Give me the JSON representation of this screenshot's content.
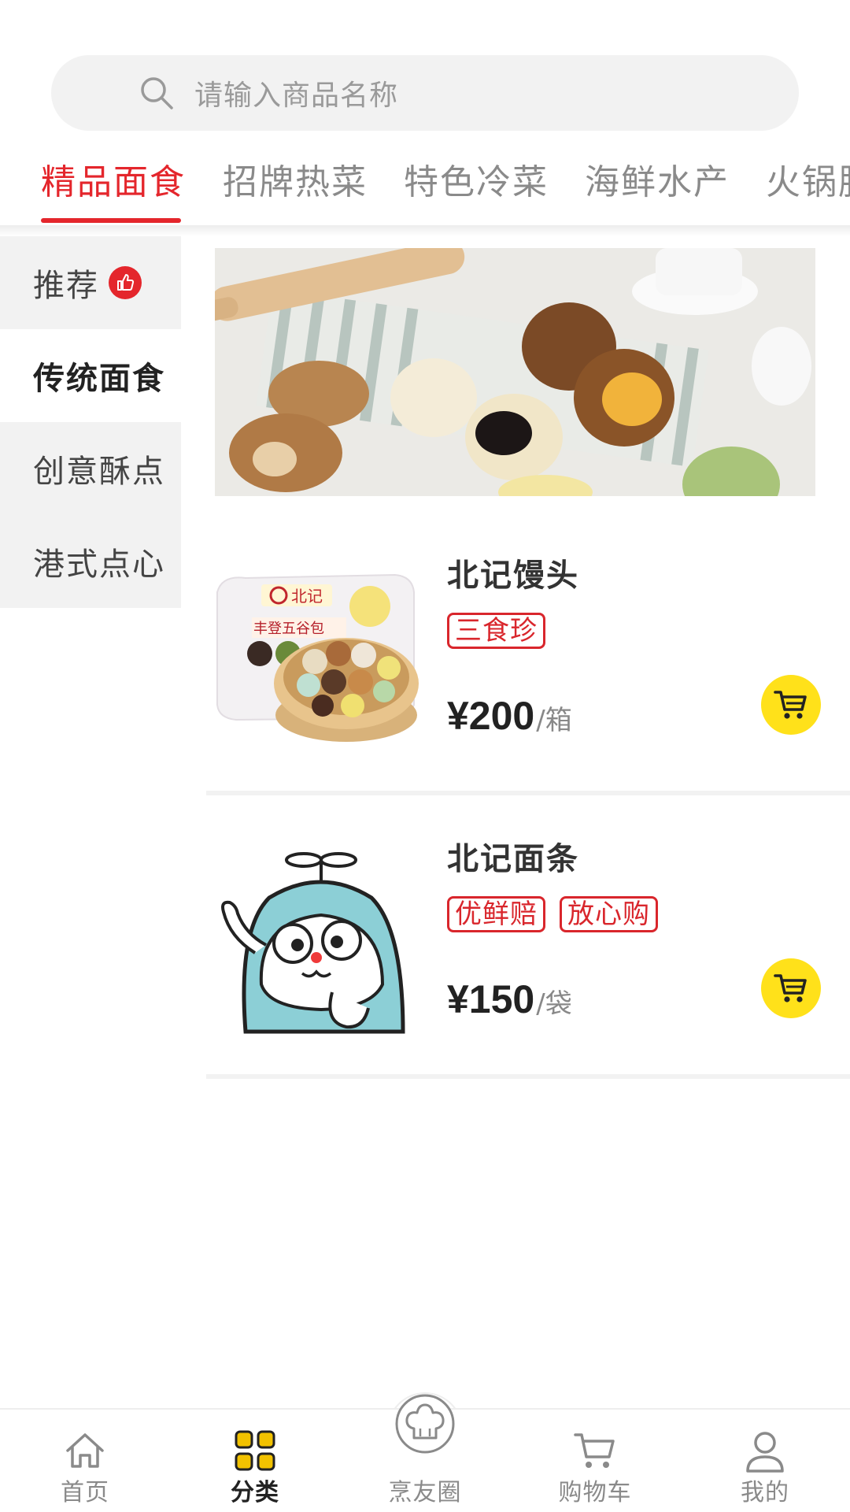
{
  "search": {
    "placeholder": "请输入商品名称"
  },
  "top_tabs": [
    {
      "label": "精品面食",
      "active": true
    },
    {
      "label": "招牌热菜",
      "active": false
    },
    {
      "label": "特色冷菜",
      "active": false
    },
    {
      "label": "海鲜水产",
      "active": false
    },
    {
      "label": "火锅腸",
      "active": false
    }
  ],
  "sidebar": {
    "items": [
      {
        "label": "推荐",
        "badge_icon": "thumbs-up-icon"
      },
      {
        "label": "传统面食",
        "active": true
      },
      {
        "label": "创意酥点"
      },
      {
        "label": "港式点心"
      }
    ]
  },
  "products": [
    {
      "name": "北记馒头",
      "tags": [
        "三食珍"
      ],
      "price": "¥200",
      "unit": "/箱",
      "package_brand": "北记",
      "package_title": "丰登五谷包"
    },
    {
      "name": "北记面条",
      "tags": [
        "优鲜赔",
        "放心购"
      ],
      "price": "¥150",
      "unit": "/袋"
    }
  ],
  "bottom_nav": [
    {
      "label": "首页",
      "icon": "home-icon"
    },
    {
      "label": "分类",
      "icon": "category-grid-icon",
      "active": true
    },
    {
      "label": "烹友圈",
      "icon": "chef-hat-icon"
    },
    {
      "label": "购物车",
      "icon": "cart-icon"
    },
    {
      "label": "我的",
      "icon": "profile-icon"
    }
  ],
  "colors": {
    "accent": "#e4262c",
    "cart_button": "#ffe11a",
    "category_active": "#f2c200"
  }
}
